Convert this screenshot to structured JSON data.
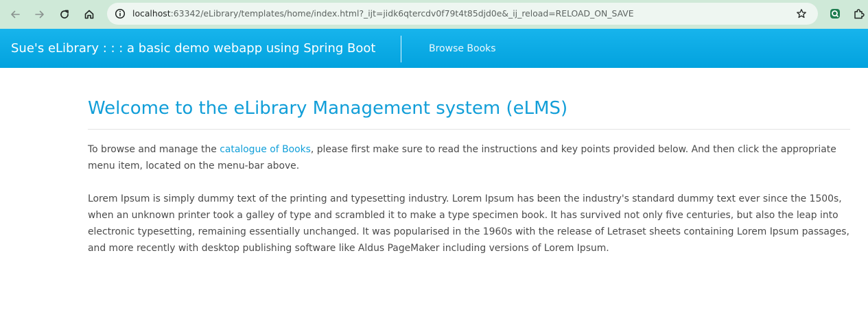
{
  "browser": {
    "url_host": "localhost",
    "url_rest": ":63342/eLibrary/templates/home/index.html?_ijt=jidk6qtercdv0f79t4t85djd0e&_ij_reload=RELOAD_ON_SAVE",
    "icons": [
      "back-arrow-icon",
      "forward-arrow-icon",
      "reload-icon",
      "home-icon",
      "site-info-icon",
      "bookmark-star-icon",
      "extension-icon",
      "puzzle-icon"
    ]
  },
  "navbar": {
    "brand": "Sue's eLibrary : : : a basic demo webapp using Spring Boot",
    "links": [
      {
        "label": "Browse Books"
      }
    ],
    "accent_color": "#0aa8e4"
  },
  "main": {
    "title": "Welcome to the eLibrary Management system (eLMS)",
    "para1_before": "To browse and manage the ",
    "para1_link": "catalogue of Books",
    "para1_after": ", please first make sure to read the instructions and key points provided below. And then click the appropriate menu item, located on the menu-bar above.",
    "para2": "Lorem Ipsum is simply dummy text of the printing and typesetting industry. Lorem Ipsum has been the industry's standard dummy text ever since the 1500s, when an unknown printer took a galley of type and scrambled it to make a type specimen book. It has survived not only five centuries, but also the leap into electronic typesetting, remaining essentially unchanged. It was popularised in the 1960s with the release of Letraset sheets containing Lorem Ipsum passages, and more recently with desktop publishing software like Aldus PageMaker including versions of Lorem Ipsum."
  }
}
